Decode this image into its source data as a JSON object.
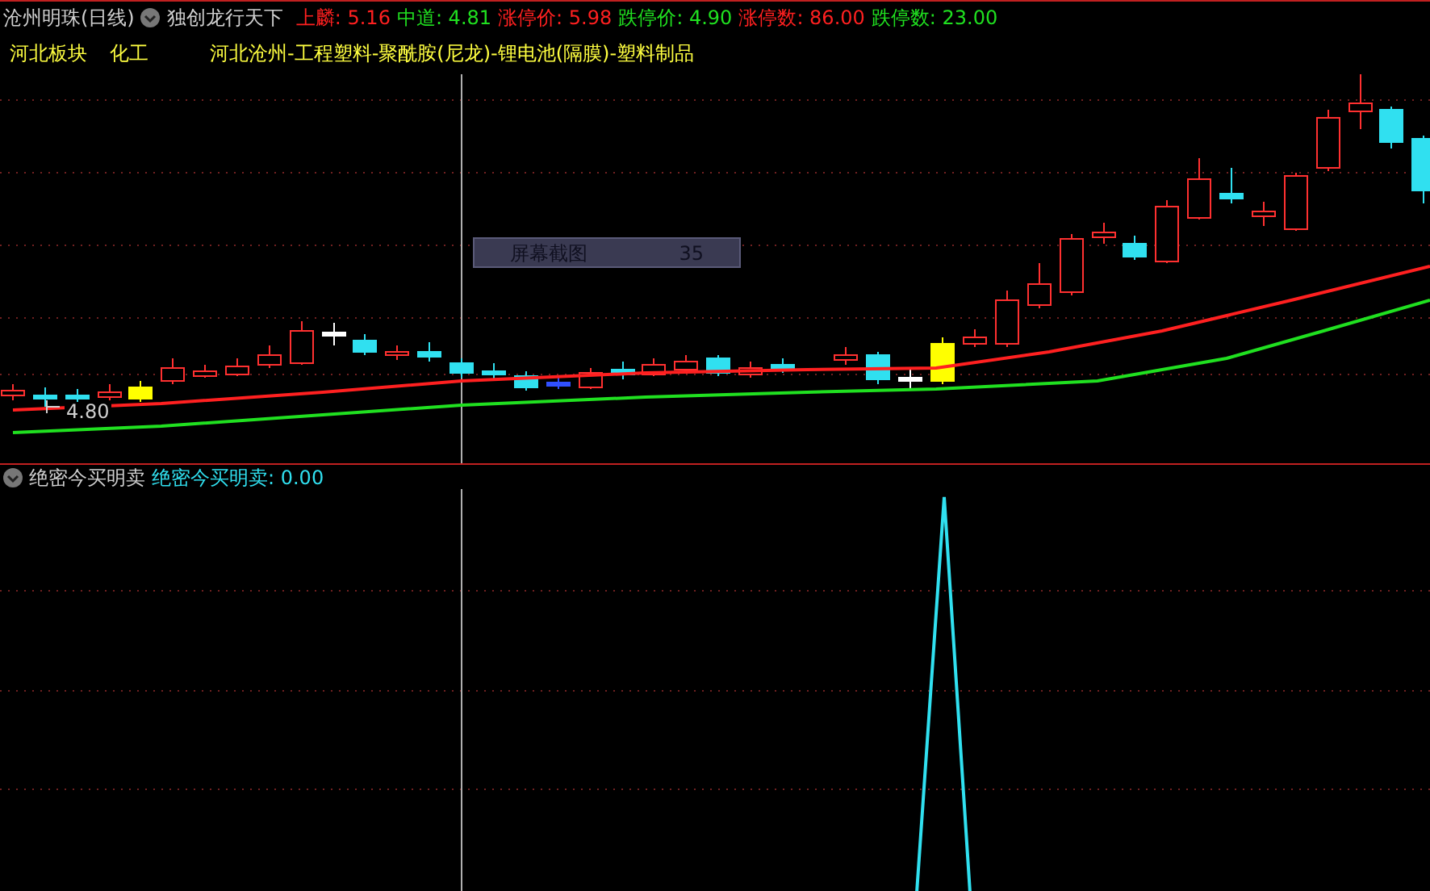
{
  "header": {
    "title": "沧州明珠(日线)",
    "indicator": "独创龙行天下",
    "readings": [
      {
        "label": "上麟:",
        "value": "5.16",
        "color": "#ff2020"
      },
      {
        "label": "中道:",
        "value": "4.81",
        "color": "#20e020"
      },
      {
        "label": "涨停价:",
        "value": "5.98",
        "color": "#ff2020"
      },
      {
        "label": "跌停价:",
        "value": "4.90",
        "color": "#20e020"
      },
      {
        "label": "涨停数:",
        "value": "86.00",
        "color": "#ff2020"
      },
      {
        "label": "跌停数:",
        "value": "23.00",
        "color": "#20e020"
      }
    ]
  },
  "tags": [
    "河北板块",
    "化工",
    "河北沧州-工程塑料-聚酰胺(尼龙)-锂电池(隔膜)-塑料制品"
  ],
  "cursor_price": "4.80",
  "popup": {
    "label": "屏幕截图",
    "count": "35"
  },
  "sub_panel": {
    "title": "绝密今买明卖",
    "reading_label": "绝密今买明卖:",
    "reading_value": "0.00"
  }
}
